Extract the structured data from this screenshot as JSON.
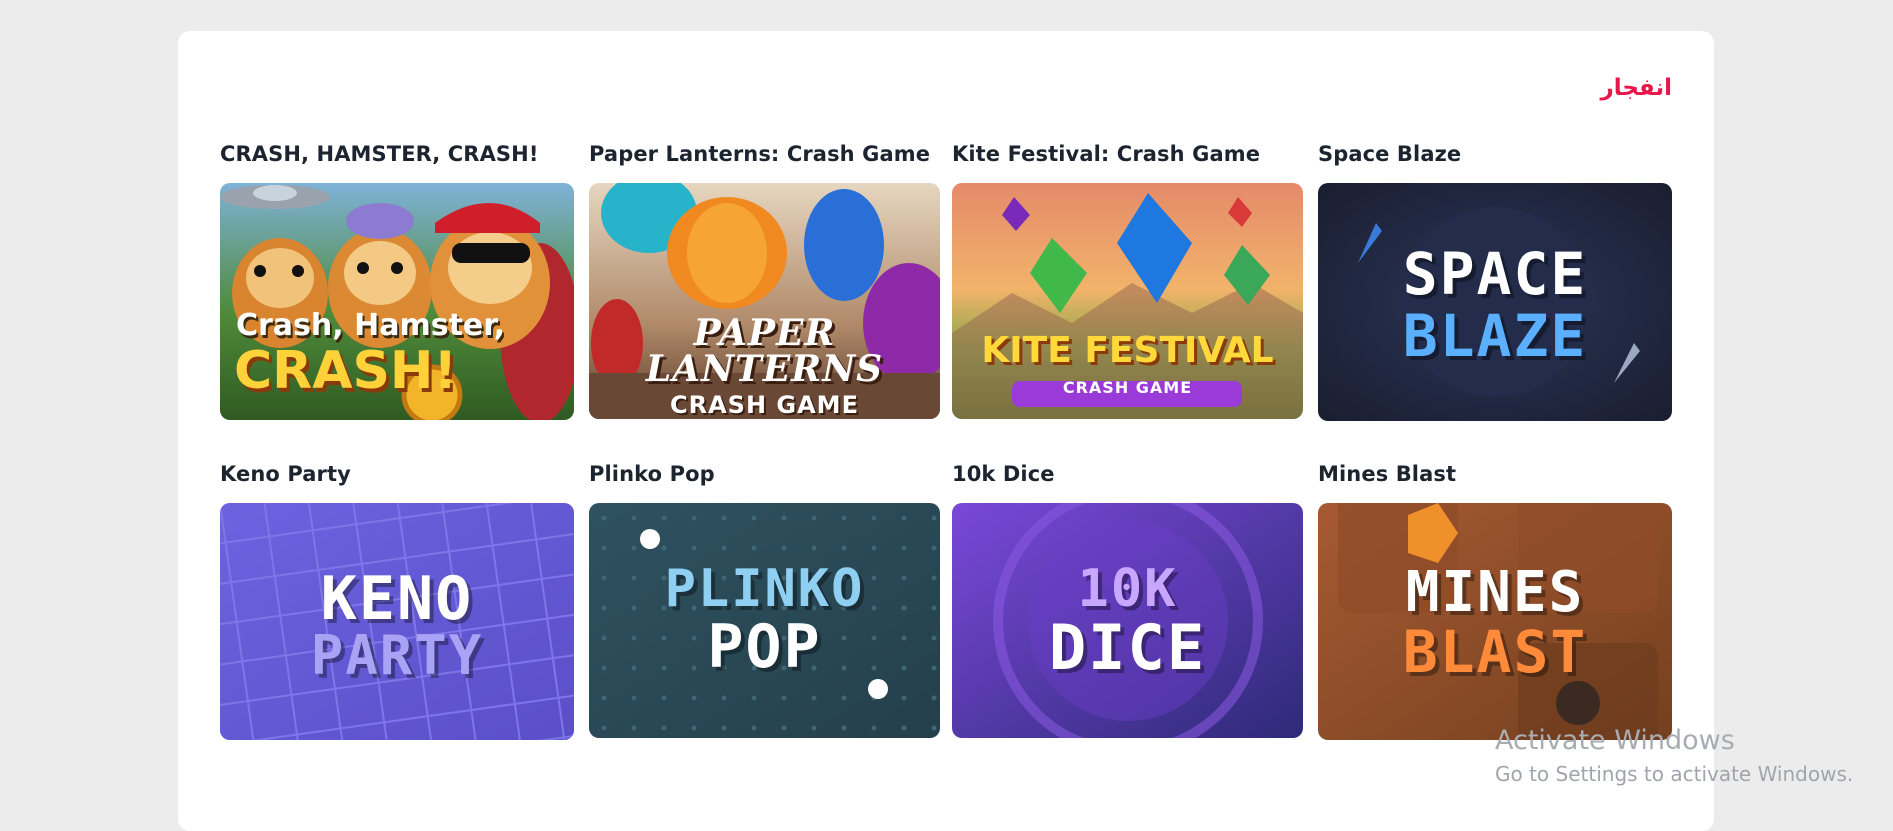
{
  "section": {
    "title": "انفجار"
  },
  "games": [
    {
      "title": "CRASH, HAMSTER, CRASH!",
      "logo_line1": "Crash, Hamster,",
      "logo_line2": "CRASH!"
    },
    {
      "title": "Paper Lanterns: Crash Game",
      "logo_line1": "PAPER LANTERNS",
      "logo_line2": "CRASH GAME"
    },
    {
      "title": "Kite Festival: Crash Game",
      "logo_line1": "KITE FESTIVAL",
      "logo_line2": "CRASH GAME"
    },
    {
      "title": "Space Blaze",
      "logo_line1": "SPACE",
      "logo_line2": "BLAZE"
    },
    {
      "title": "Keno Party",
      "logo_line1": "KENO",
      "logo_line2": "PARTY"
    },
    {
      "title": "Plinko Pop",
      "logo_line1": "PLINKO",
      "logo_line2": "POP"
    },
    {
      "title": "10k Dice",
      "logo_line1": "10K",
      "logo_line2": "DICE"
    },
    {
      "title": "Mines Blast",
      "logo_line1": "MINES",
      "logo_line2": "BLAST"
    }
  ],
  "watermark": {
    "line1": "Activate Windows",
    "line2": "Go to Settings to activate Windows."
  },
  "colors": {
    "accent": "#e8174a",
    "keno_bg": "#6a5fd8",
    "plinko_bg": "#2d4b57",
    "dice_bg": "#6b3fc4",
    "mines_bg": "#8a4a2a",
    "space_bg": "#1f2438"
  }
}
